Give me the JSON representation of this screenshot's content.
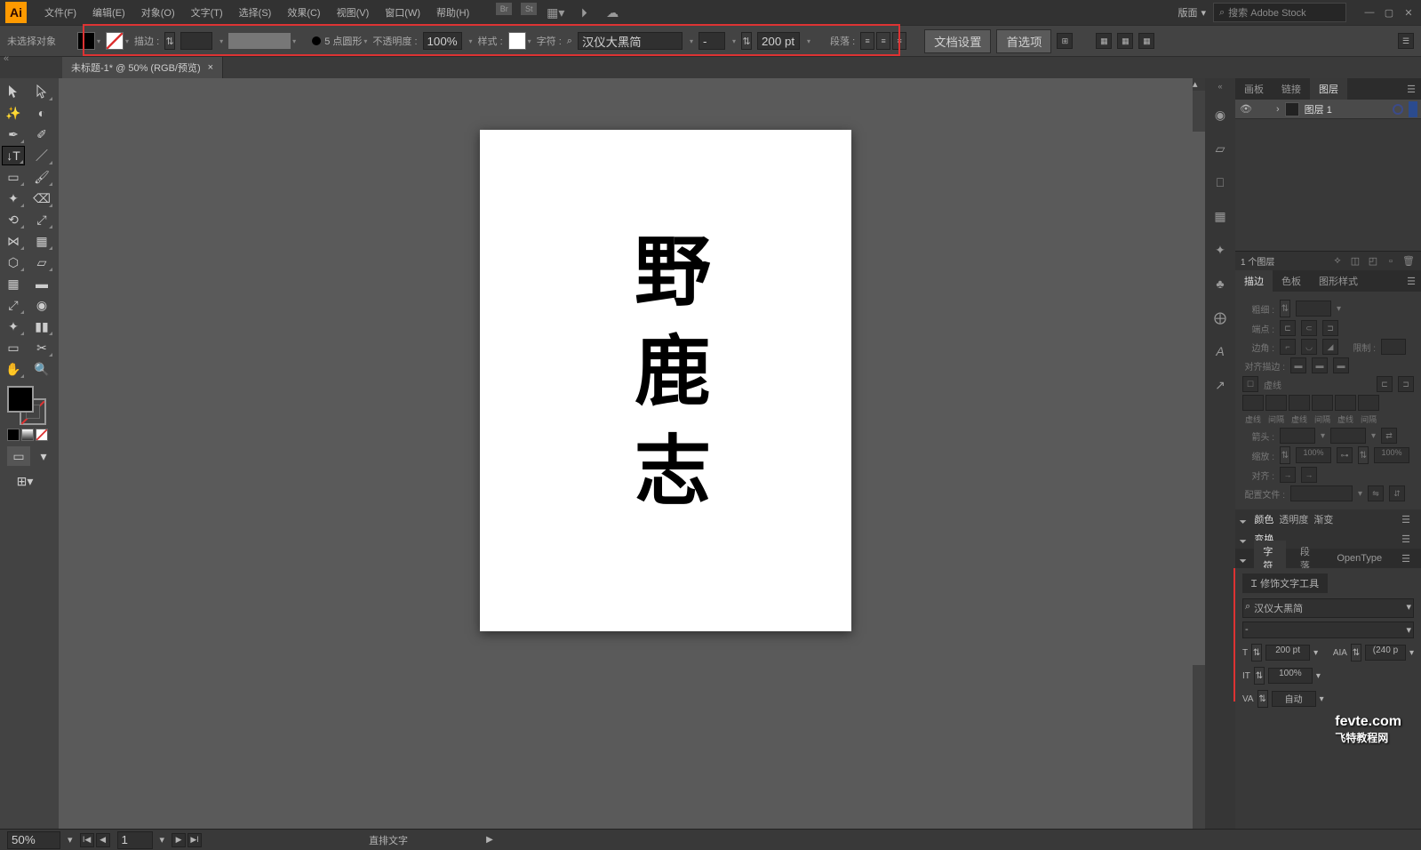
{
  "menubar": {
    "logo": "Ai",
    "items": [
      "文件(F)",
      "编辑(E)",
      "对象(O)",
      "文字(T)",
      "选择(S)",
      "效果(C)",
      "视图(V)",
      "窗口(W)",
      "帮助(H)"
    ],
    "layout_label": "版面",
    "search_placeholder": "搜索 Adobe Stock"
  },
  "controlbar": {
    "no_select": "未选择对象",
    "stroke_label": "描边 :",
    "stroke_pt": "",
    "profile": "5 点圆形",
    "opacity_label": "不透明度 :",
    "opacity_value": "100%",
    "style_label": "样式 :",
    "char_label": "字符 :",
    "font_name": "汉仪大黑简",
    "font_style": "-",
    "font_size": "200 pt",
    "para_label": "段落 :",
    "doc_setup": "文档设置",
    "prefs": "首选项"
  },
  "tab": {
    "title": "未标题-1* @ 50% (RGB/预览)"
  },
  "canvas": {
    "text": "野鹿志"
  },
  "layers_panel": {
    "tabs": [
      "画板",
      "链接",
      "图层"
    ],
    "layer1": "图层 1",
    "count": "1 个图层"
  },
  "stroke_panel": {
    "tabs": [
      "描边",
      "色板",
      "图形样式"
    ],
    "weight_label": "粗细 :",
    "cap_label": "端点 :",
    "corner_label": "边角 :",
    "limit_label": "限制 :",
    "align_label": "对齐描边 :",
    "dash_label": "虚线",
    "dash_cols": [
      "虚线",
      "间隔",
      "虚线",
      "间隔",
      "虚线",
      "间隔"
    ],
    "arrow_label": "箭头 :",
    "scale_label": "缩放 :",
    "scale_value": "100%",
    "alignarrow_label": "对齐 :",
    "profile_label": "配置文件 :"
  },
  "color_header": {
    "color": "颜色",
    "opacity": "透明度",
    "gradient": "渐变"
  },
  "transform_header": "变换",
  "char_tabs": [
    "字符",
    "段落",
    "OpenType"
  ],
  "char_panel": {
    "touch_tool": "修饰文字工具",
    "font": "汉仪大黑简",
    "style": "-",
    "size": "200 pt",
    "leading": "(240 p",
    "vscale": "100%",
    "kern": "自动"
  },
  "status": {
    "zoom": "50%",
    "artboard": "1",
    "mode": "直排文字"
  },
  "watermark": {
    "en": "fevte.com",
    "cn": "飞特教程网"
  }
}
